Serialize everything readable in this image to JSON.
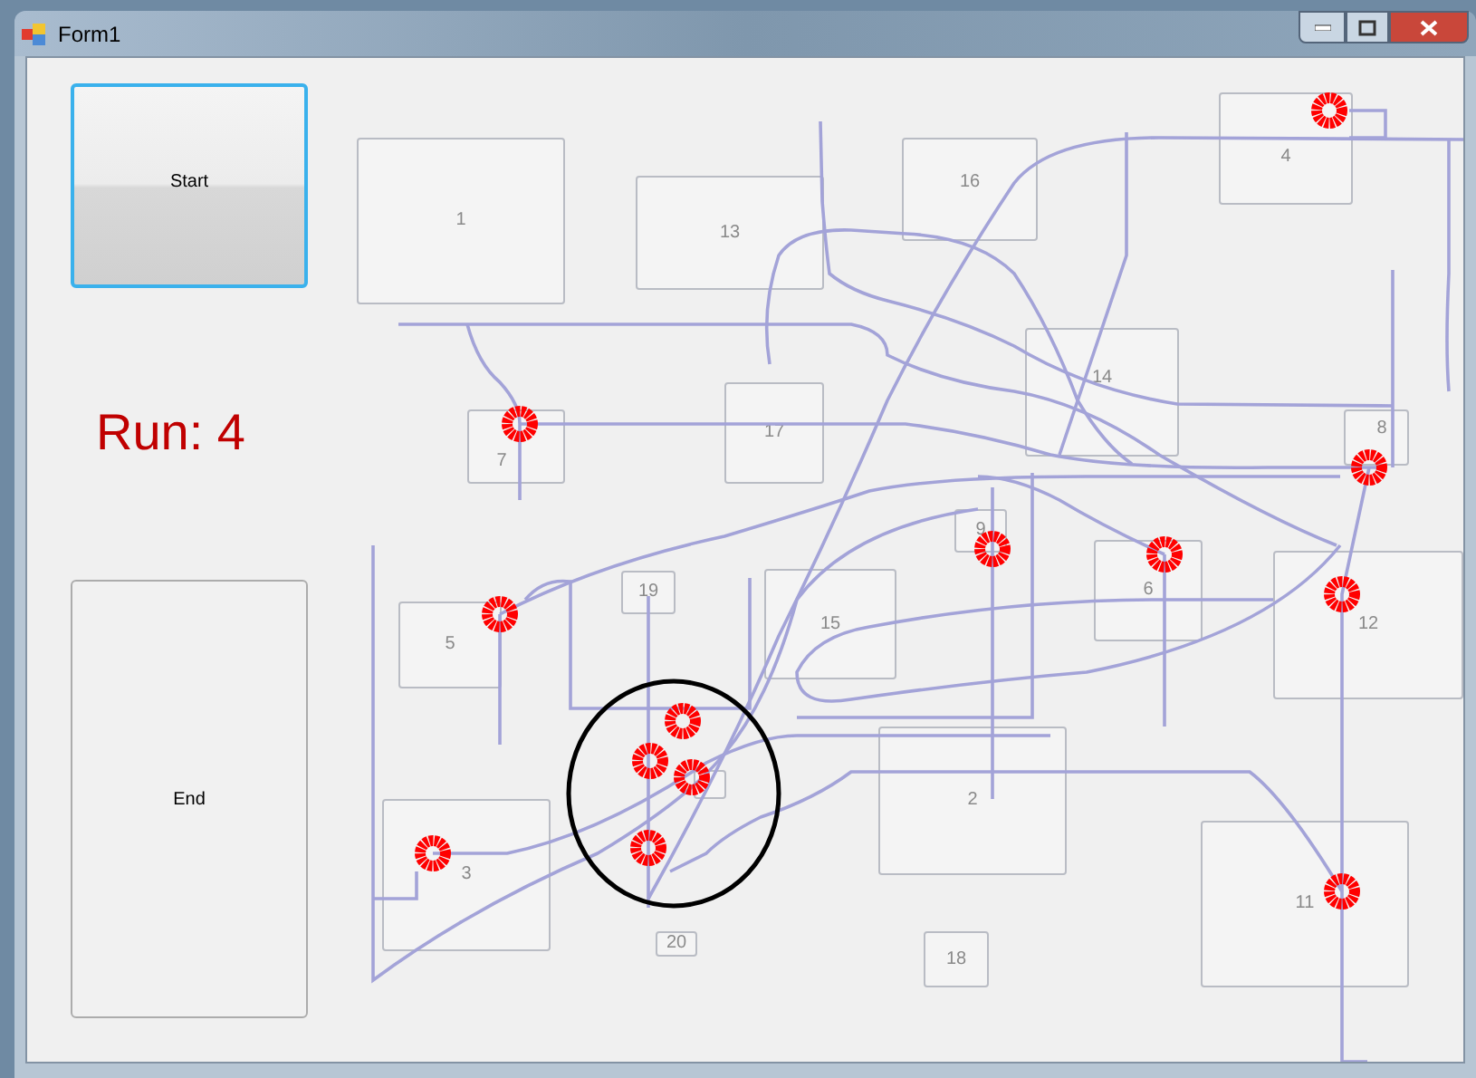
{
  "window": {
    "title": "Form1"
  },
  "buttons": [
    {
      "label": "Start",
      "focused": true
    },
    {
      "label": "End",
      "focused": false
    }
  ],
  "run_label": "Run: 4",
  "nodes": [
    {
      "kind": "labeled",
      "label": "1"
    },
    {
      "kind": "labeled",
      "label": "13"
    },
    {
      "kind": "labeled",
      "label": "16"
    },
    {
      "kind": "labeled",
      "label": "4"
    },
    {
      "kind": "labeled",
      "label": "7"
    },
    {
      "kind": "labeled",
      "label": "17"
    },
    {
      "kind": "labeled",
      "label": "14"
    },
    {
      "kind": "labeled",
      "label": "8"
    },
    {
      "kind": "labeled",
      "label": "9"
    },
    {
      "kind": "labeled",
      "label": "6"
    },
    {
      "kind": "labeled",
      "label": "12"
    },
    {
      "kind": "labeled",
      "label": "5"
    },
    {
      "kind": "labeled",
      "label": "19"
    },
    {
      "kind": "labeled",
      "label": "15"
    },
    {
      "kind": "labeled",
      "label": "2"
    },
    {
      "kind": "unlabeled"
    },
    {
      "kind": "labeled",
      "label": "3"
    },
    {
      "kind": "labeled",
      "label": "11"
    },
    {
      "kind": "labeled",
      "label": "20"
    },
    {
      "kind": "labeled",
      "label": "18"
    }
  ]
}
